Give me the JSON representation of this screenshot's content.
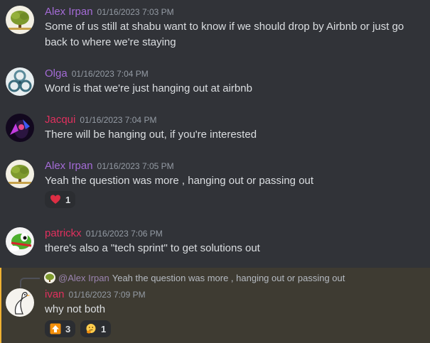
{
  "colors": {
    "alex": "#a46bd6",
    "olga": "#a46bd6",
    "jacqui": "#e0305e",
    "patrickx": "#e0305e",
    "ivan": "#e0305e",
    "reply_highlight": "#3e3b32"
  },
  "messages": [
    {
      "username": "Alex Irpan",
      "timestamp": "01/16/2023 7:03 PM",
      "text": "Some of us still at shabu want to know if we should drop by Airbnb or just go back to where we're staying",
      "avatar": "tree-avatar"
    },
    {
      "username": "Olga",
      "timestamp": "01/16/2023 7:04 PM",
      "text": "Word is that we're just hanging out at airbnb",
      "avatar": "triskele-avatar"
    },
    {
      "username": "Jacqui",
      "timestamp": "01/16/2023 7:04 PM",
      "text": "There will be hanging out, if you're interested",
      "avatar": "neon-portrait-avatar"
    },
    {
      "username": "Alex Irpan",
      "timestamp": "01/16/2023 7:05 PM",
      "text": "Yeah the question was more , hanging out or passing out",
      "avatar": "tree-avatar",
      "reactions": [
        {
          "emoji": "red-heart",
          "count": "1"
        }
      ]
    },
    {
      "username": "patrickx",
      "timestamp": "01/16/2023 7:06 PM",
      "text": "there's also a \"tech sprint\" to get solutions out",
      "avatar": "yoshi-avatar"
    },
    {
      "username": "ivan",
      "timestamp": "01/16/2023 7:09 PM",
      "text": "why not both",
      "avatar": "goose-avatar",
      "reply": {
        "mention": "@Alex Irpan",
        "text": "Yeah the question was more , hanging out or passing out"
      },
      "reactions": [
        {
          "emoji": "up-arrow",
          "count": "3"
        },
        {
          "emoji": "thinking-face",
          "count": "1"
        }
      ]
    }
  ]
}
